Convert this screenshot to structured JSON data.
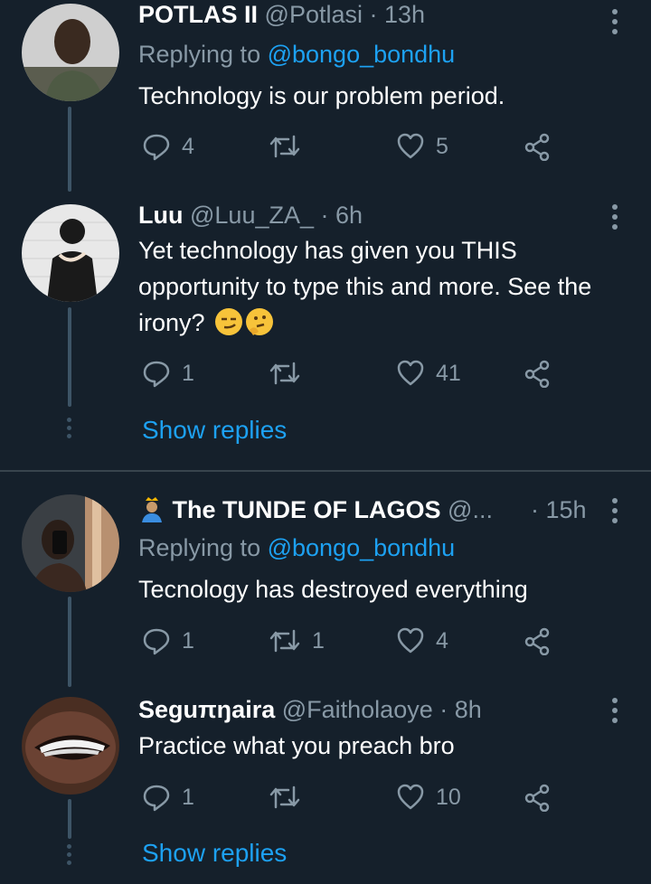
{
  "tweets": [
    {
      "name": "POTLAS II",
      "handle": "@Potlasi",
      "time": "· 13h",
      "replying_prefix": "Replying to ",
      "replying_to": "@bongo_bondhu",
      "text": "Technology is our problem period.",
      "replies": "4",
      "retweets": "",
      "likes": "5"
    },
    {
      "name": "Luu",
      "handle": "@Luu_ZA_",
      "time": "· 6h",
      "text": "Yet technology has given you THIS opportunity to type this and more. See the irony?",
      "emojis": [
        "smirking-face-icon",
        "thinking-face-icon"
      ],
      "replies": "1",
      "retweets": "",
      "likes": "41",
      "show_replies": "Show replies"
    },
    {
      "name": "The TUNDE OF LAGOS",
      "handle": "@...",
      "time": "· 15h",
      "name_icon": "person-with-crown-icon",
      "replying_prefix": "Replying to ",
      "replying_to": "@bongo_bondhu",
      "text": "Tecnology has destroyed everything",
      "replies": "1",
      "retweets": "1",
      "likes": "4"
    },
    {
      "name": "Seguπŋaira",
      "handle": "@Faitholaoye",
      "time": "· 8h",
      "text": "Practice what you preach bro",
      "replies": "1",
      "retweets": "",
      "likes": "10",
      "show_replies": "Show replies"
    }
  ],
  "colors": {
    "background": "#15202b",
    "secondary_text": "#8899a6",
    "link": "#1da1f2",
    "thread_line": "#3d5466",
    "divider": "#38444d"
  }
}
